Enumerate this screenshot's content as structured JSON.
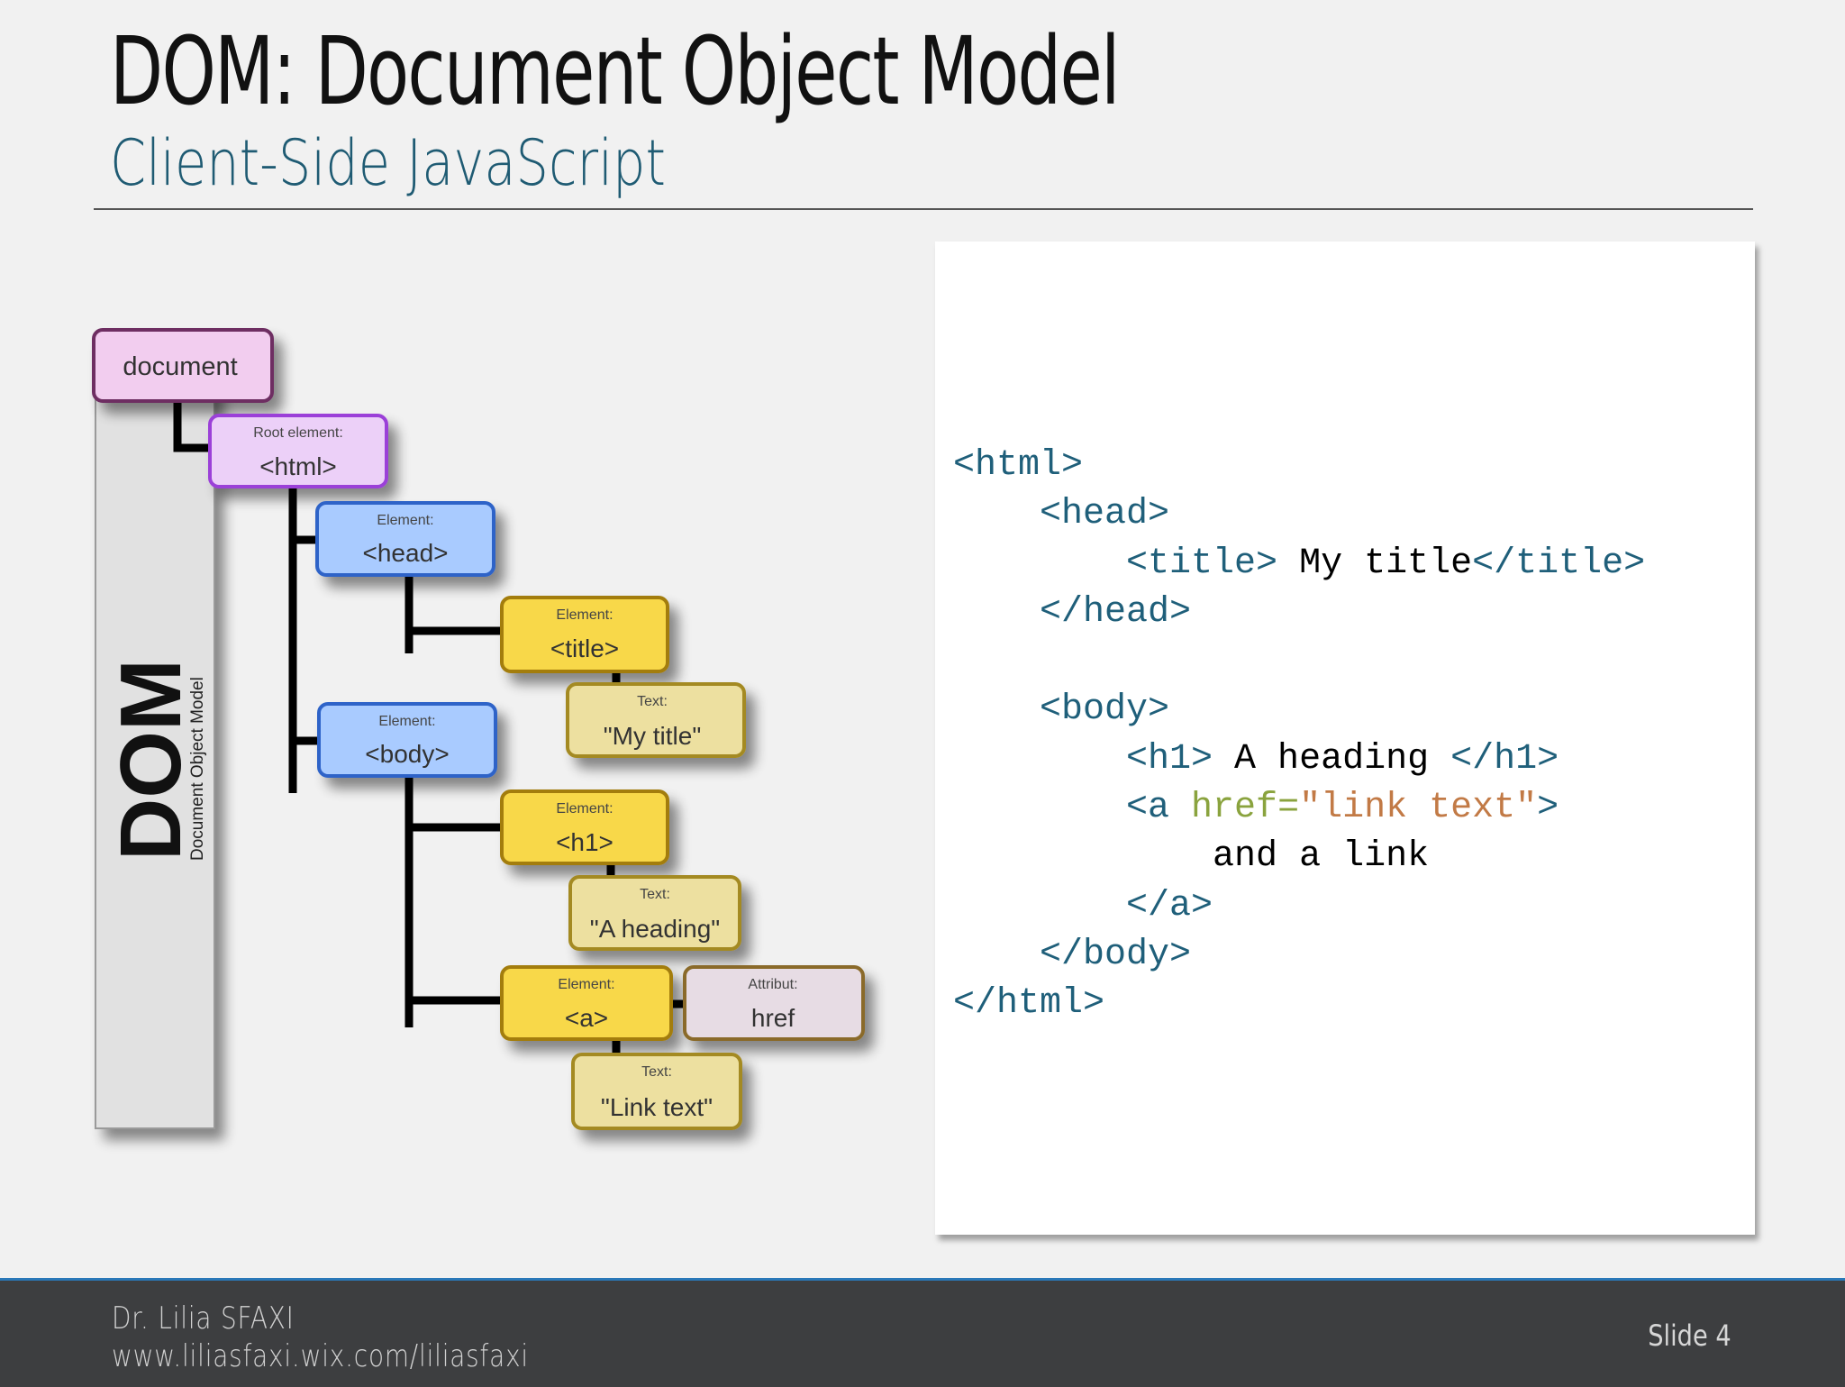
{
  "slide": {
    "title": "DOM: Document Object Model",
    "subtitle": "Client-Side JavaScript"
  },
  "diagram": {
    "side_big": "DOM",
    "side_small": "Document Object Model",
    "nodes": {
      "document": {
        "label": "document"
      },
      "html": {
        "type": "Root element:",
        "label": "<html>"
      },
      "head": {
        "type": "Element:",
        "label": "<head>"
      },
      "title": {
        "type": "Element:",
        "label": "<title>"
      },
      "title_text": {
        "type": "Text:",
        "label": "\"My title\""
      },
      "body": {
        "type": "Element:",
        "label": "<body>"
      },
      "h1": {
        "type": "Element:",
        "label": "<h1>"
      },
      "h1_text": {
        "type": "Text:",
        "label": "\"A heading\""
      },
      "a": {
        "type": "Element:",
        "label": "<a>"
      },
      "href": {
        "type": "Attribut:",
        "label": "href"
      },
      "a_text": {
        "type": "Text:",
        "label": "\"Link text\""
      }
    },
    "colors": {
      "document": "#f2cdef",
      "html": "#ecd0f8",
      "element_blue": "#a9cbff",
      "element_yellow": "#f8d84a",
      "text": "#ede0a0",
      "attribute": "#e7dce4"
    }
  },
  "code": {
    "l1": "<html>",
    "l2": "<head>",
    "l3_open": "<title>",
    "l3_text": " My title",
    "l3_close": "</title>",
    "l4": "</head>",
    "l5": "<body>",
    "l6_open": "<h1>",
    "l6_text": " A heading ",
    "l6_close": "</h1>",
    "l7_open": "<a ",
    "l7_attr": "href=",
    "l7_val": "\"link text\"",
    "l7_close": ">",
    "l8": "and a link",
    "l9": "</a>",
    "l10": "</body>",
    "l11": "</html>"
  },
  "footer": {
    "author": "Dr. Lilia SFAXI",
    "url": "www.liliasfaxi.wix.com/liliasfaxi",
    "slide": "Slide 4"
  }
}
